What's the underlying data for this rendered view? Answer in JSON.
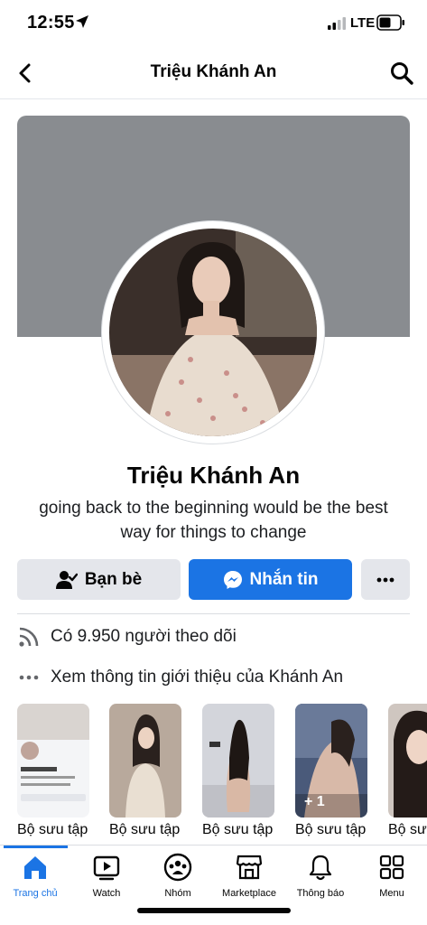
{
  "status_bar": {
    "time": "12:55",
    "network": "LTE"
  },
  "header": {
    "title": "Triệu Khánh An"
  },
  "profile": {
    "name": "Triệu Khánh An",
    "bio": "going back to the beginning would be the best way for things to change"
  },
  "actions": {
    "friends_label": "Bạn bè",
    "message_label": "Nhắn tin"
  },
  "info": {
    "followers": "Có 9.950 người theo dõi",
    "about": "Xem thông tin giới thiệu của Khánh An"
  },
  "collections": [
    {
      "label": "Bộ sưu tập"
    },
    {
      "label": "Bộ sưu tập"
    },
    {
      "label": "Bộ sưu tập"
    },
    {
      "label": "Bộ sưu tập",
      "badge": "+ 1"
    },
    {
      "label": "Bộ sưu tập"
    }
  ],
  "tabs": [
    {
      "label": "Trang chủ",
      "icon": "home-icon",
      "active": true
    },
    {
      "label": "Watch",
      "icon": "watch-icon"
    },
    {
      "label": "Nhóm",
      "icon": "groups-icon"
    },
    {
      "label": "Marketplace",
      "icon": "marketplace-icon"
    },
    {
      "label": "Thông báo",
      "icon": "bell-icon"
    },
    {
      "label": "Menu",
      "icon": "menu-grid-icon"
    }
  ],
  "colors": {
    "accent": "#1b74e4",
    "cover": "#898c90",
    "button_gray": "#e4e6eb"
  }
}
